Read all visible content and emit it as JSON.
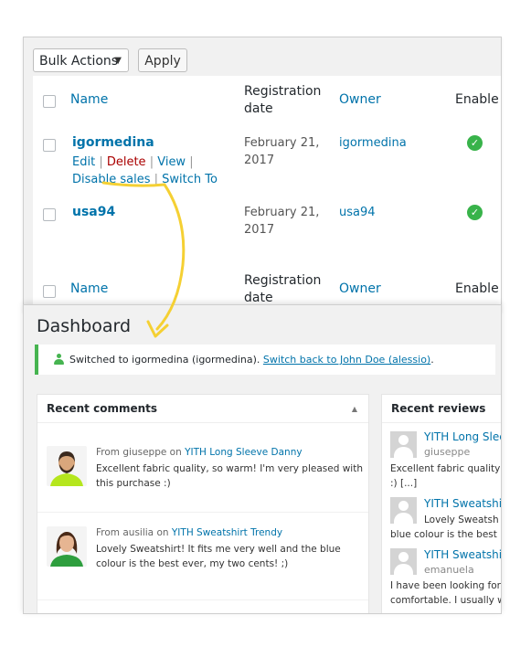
{
  "users_screen": {
    "bulk_actions": {
      "selected": "Bulk Actions",
      "apply_label": "Apply"
    },
    "columns": {
      "name": "Name",
      "registration_date": "Registration date",
      "owner": "Owner",
      "enabled": "Enable"
    },
    "rows": [
      {
        "username": "igormedina",
        "registration_date": "February 21, 2017",
        "owner": "igormedina",
        "enabled_icon": "check-icon",
        "actions": {
          "edit": "Edit",
          "delete": "Delete",
          "view": "View",
          "disable_sales": "Disable sales",
          "switch_to": "Switch To"
        }
      },
      {
        "username": "usa94",
        "registration_date": "February 21, 2017",
        "owner": "usa94",
        "enabled_icon": "check-icon"
      }
    ],
    "enabled_color": "#38b34a",
    "delete_color": "#aa0000"
  },
  "annotation": {
    "arrow_color": "#f5d033"
  },
  "dashboard": {
    "title": "Dashboard",
    "notice": {
      "prefix": "Switched to igormedina (igormedina).",
      "link": "Switch back to John Doe (alessio)",
      "suffix": ".",
      "icon": "user-icon",
      "accent": "#46b450"
    },
    "recent_comments": {
      "title": "Recent comments",
      "toggle_icon": "triangle-up-icon",
      "items": [
        {
          "from_label": "From",
          "author": "giuseppe",
          "on_label": "on",
          "product": "YITH Long Sleeve Danny",
          "text": "Excellent fabric quality, so warm! I'm very pleased with this purchase :)"
        },
        {
          "from_label": "From",
          "author": "ausilia",
          "on_label": "on",
          "product": "YITH Sweatshirt Trendy",
          "text": "Lovely Sweatshirt! It fits me very well and the blue colour is the best ever, my two cents! ;)"
        }
      ]
    },
    "recent_reviews": {
      "title": "Recent reviews",
      "items": [
        {
          "product": "YITH Long Slee",
          "user": "giuseppe",
          "text_lines": [
            "Excellent fabric quality",
            ":) [...]"
          ]
        },
        {
          "product": "YITH Sweatshi",
          "user": "",
          "text_lines": [
            "Lovely Sweatsh",
            "blue colour is the best"
          ]
        },
        {
          "product": "YITH Sweatshi",
          "user": "emanuela",
          "text_lines": [
            "I have been looking for",
            "comfortable. I usually w"
          ]
        }
      ]
    }
  }
}
